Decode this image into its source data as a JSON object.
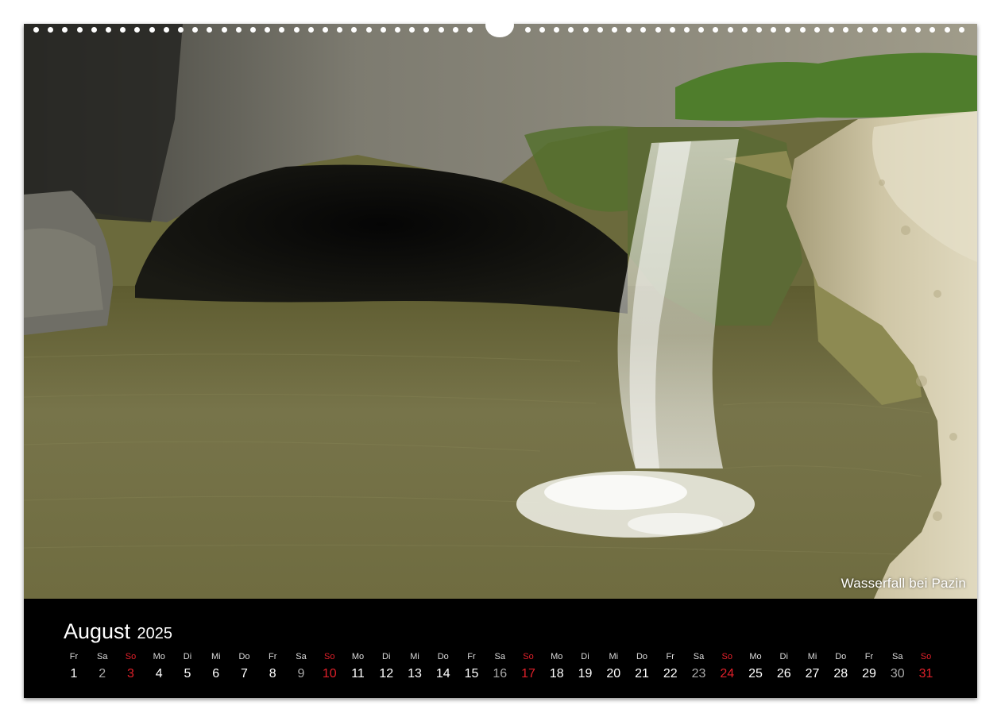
{
  "photo": {
    "caption": "Wasserfall bei Pazin"
  },
  "calendar": {
    "month": "August",
    "year": "2025",
    "colors": {
      "sunday": "#e0202a",
      "saturday": "#aaaaaa",
      "weekday": "#ffffff",
      "background": "#000000"
    },
    "days": [
      {
        "weekday": "Fr",
        "day": "1"
      },
      {
        "weekday": "Sa",
        "day": "2"
      },
      {
        "weekday": "So",
        "day": "3"
      },
      {
        "weekday": "Mo",
        "day": "4"
      },
      {
        "weekday": "Di",
        "day": "5"
      },
      {
        "weekday": "Mi",
        "day": "6"
      },
      {
        "weekday": "Do",
        "day": "7"
      },
      {
        "weekday": "Fr",
        "day": "8"
      },
      {
        "weekday": "Sa",
        "day": "9"
      },
      {
        "weekday": "So",
        "day": "10"
      },
      {
        "weekday": "Mo",
        "day": "11"
      },
      {
        "weekday": "Di",
        "day": "12"
      },
      {
        "weekday": "Mi",
        "day": "13"
      },
      {
        "weekday": "Do",
        "day": "14"
      },
      {
        "weekday": "Fr",
        "day": "15"
      },
      {
        "weekday": "Sa",
        "day": "16"
      },
      {
        "weekday": "So",
        "day": "17"
      },
      {
        "weekday": "Mo",
        "day": "18"
      },
      {
        "weekday": "Di",
        "day": "19"
      },
      {
        "weekday": "Mi",
        "day": "20"
      },
      {
        "weekday": "Do",
        "day": "21"
      },
      {
        "weekday": "Fr",
        "day": "22"
      },
      {
        "weekday": "Sa",
        "day": "23"
      },
      {
        "weekday": "So",
        "day": "24"
      },
      {
        "weekday": "Mo",
        "day": "25"
      },
      {
        "weekday": "Di",
        "day": "26"
      },
      {
        "weekday": "Mi",
        "day": "27"
      },
      {
        "weekday": "Do",
        "day": "28"
      },
      {
        "weekday": "Fr",
        "day": "29"
      },
      {
        "weekday": "Sa",
        "day": "30"
      },
      {
        "weekday": "So",
        "day": "31"
      }
    ]
  }
}
